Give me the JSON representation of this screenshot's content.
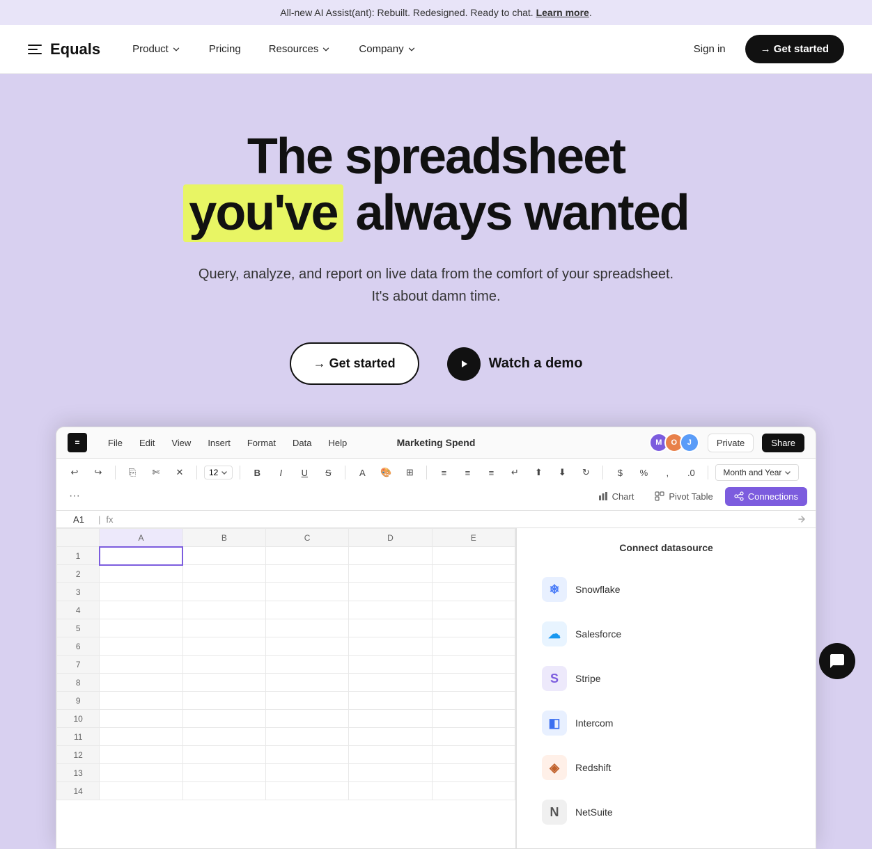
{
  "announcement": {
    "text": "All-new AI Assist(ant): Rebuilt. Redesigned. Ready to chat.",
    "link_text": "Learn more",
    "link_url": "#"
  },
  "nav": {
    "logo_text": "Equals",
    "links": [
      {
        "label": "Product",
        "has_dropdown": true
      },
      {
        "label": "Pricing",
        "has_dropdown": false
      },
      {
        "label": "Resources",
        "has_dropdown": true
      },
      {
        "label": "Company",
        "has_dropdown": true
      }
    ],
    "sign_in": "Sign in",
    "get_started": "→ Get started"
  },
  "hero": {
    "heading_line1": "The spreadsheet",
    "heading_line2_highlight": "you've",
    "heading_line2_rest": " always wanted",
    "subtitle_line1": "Query, analyze, and report on live data from the comfort of your spreadsheet.",
    "subtitle_line2": "It's about damn time.",
    "cta_primary": "→ Get started",
    "cta_secondary": "Watch a demo"
  },
  "spreadsheet": {
    "toolbar": {
      "menu_items": [
        "File",
        "Edit",
        "View",
        "Insert",
        "Format",
        "Data",
        "Help"
      ],
      "title": "Marketing Spend",
      "avatars": [
        "M",
        "O",
        "J"
      ],
      "private_btn": "Private",
      "share_btn": "Share"
    },
    "format_bar": {
      "font_size": "12",
      "dropdown_label": "Month and Year"
    },
    "cell_ref": "A1",
    "formula_icon": "fx",
    "panel_tabs": [
      {
        "label": "Chart",
        "active": false
      },
      {
        "label": "Pivot Table",
        "active": false
      },
      {
        "label": "Connections",
        "active": true
      }
    ],
    "panel_title": "Connect datasource",
    "datasources": [
      {
        "name": "Snowflake",
        "icon": "❄",
        "color_class": "ds-snowflake"
      },
      {
        "name": "Salesforce",
        "icon": "☁",
        "color_class": "ds-salesforce"
      },
      {
        "name": "Stripe",
        "icon": "S",
        "color_class": "ds-stripe"
      },
      {
        "name": "Intercom",
        "icon": "◧",
        "color_class": "ds-intercom"
      },
      {
        "name": "Redshift",
        "icon": "◈",
        "color_class": "ds-redshift"
      },
      {
        "name": "NetSuite",
        "icon": "N",
        "color_class": "ds-netsuite"
      }
    ],
    "columns": [
      "A",
      "B",
      "C",
      "D",
      "E"
    ],
    "row_count": 14
  }
}
